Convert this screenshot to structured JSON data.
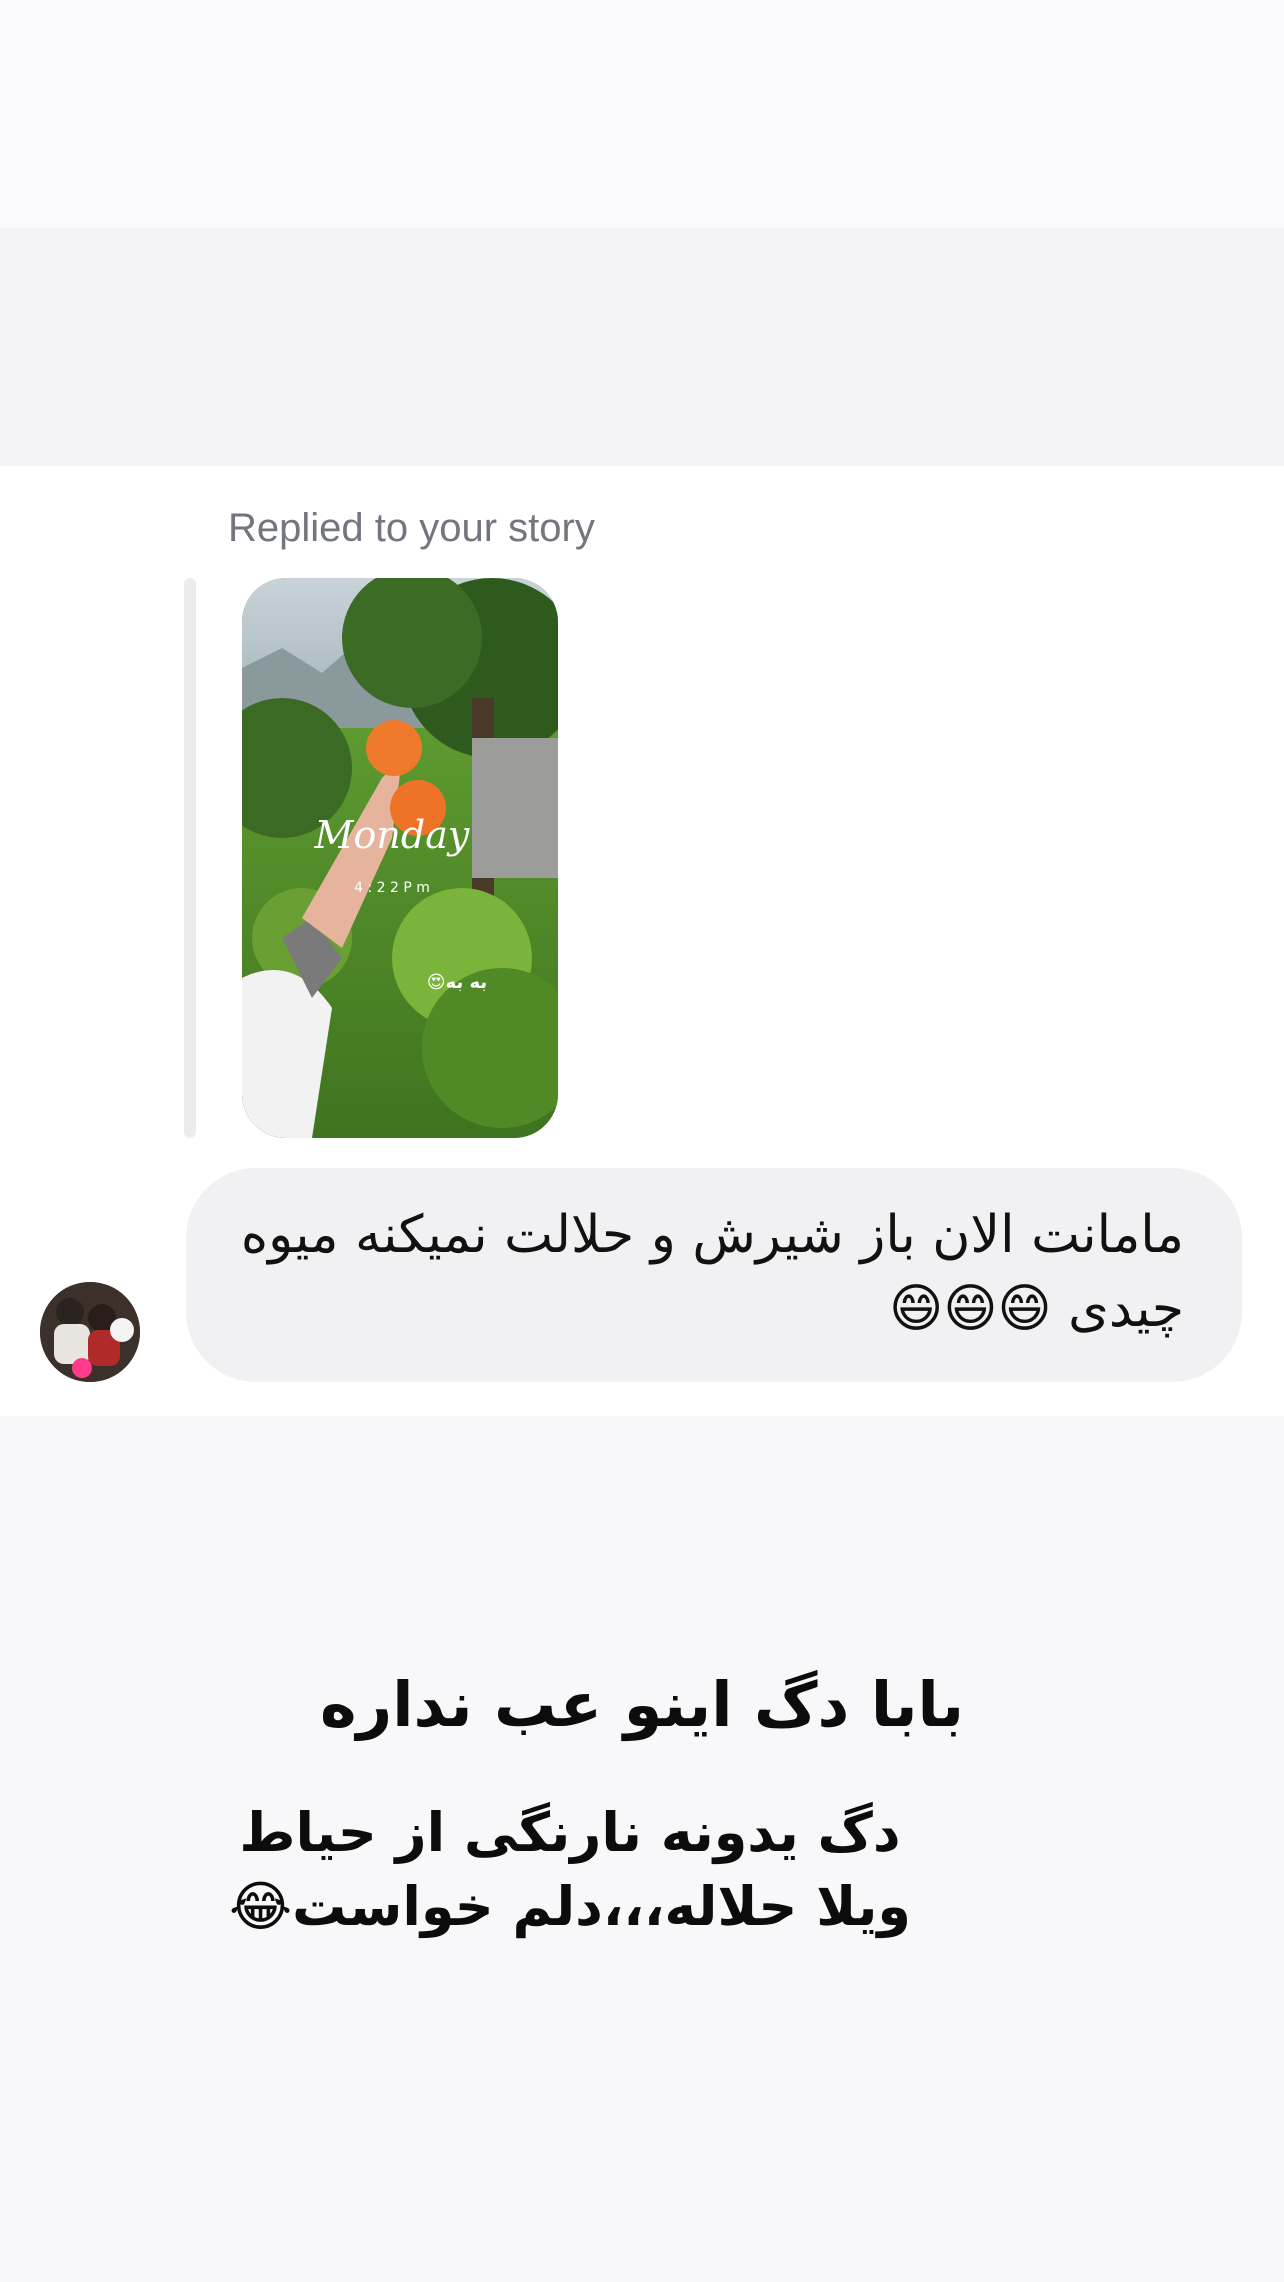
{
  "story_reply": {
    "label": "Replied to your story",
    "thumbnail": {
      "overlay_script": "Monday",
      "overlay_time": "4 : 2 2  P m",
      "overlay_sticker": "به به😍"
    }
  },
  "message": {
    "text": "مامانت الان باز شیرش و حلالت نمیکنه میوه چیدی 😄😄😄"
  },
  "caption": {
    "title": "بابا دگ اینو عب نداره",
    "body": "دگ یدونه نارنگی  از حیاط ویلا حلاله،،،دلم خواست😂"
  },
  "colors": {
    "bubble": "#f1f1f4",
    "label": "#737580",
    "background": "#f8f8fa"
  }
}
